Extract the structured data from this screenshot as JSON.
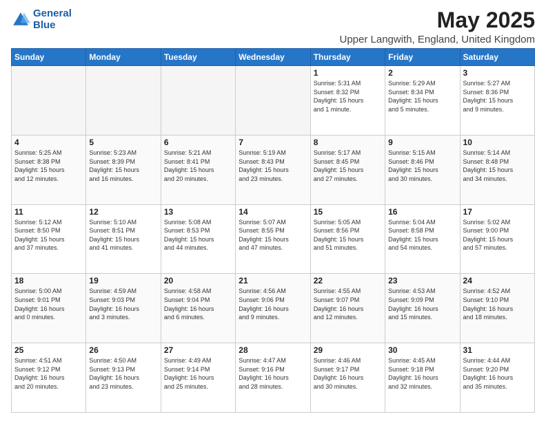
{
  "logo": {
    "line1": "General",
    "line2": "Blue"
  },
  "title": "May 2025",
  "location": "Upper Langwith, England, United Kingdom",
  "weekdays": [
    "Sunday",
    "Monday",
    "Tuesday",
    "Wednesday",
    "Thursday",
    "Friday",
    "Saturday"
  ],
  "weeks": [
    [
      {
        "day": "",
        "info": ""
      },
      {
        "day": "",
        "info": ""
      },
      {
        "day": "",
        "info": ""
      },
      {
        "day": "",
        "info": ""
      },
      {
        "day": "1",
        "info": "Sunrise: 5:31 AM\nSunset: 8:32 PM\nDaylight: 15 hours\nand 1 minute."
      },
      {
        "day": "2",
        "info": "Sunrise: 5:29 AM\nSunset: 8:34 PM\nDaylight: 15 hours\nand 5 minutes."
      },
      {
        "day": "3",
        "info": "Sunrise: 5:27 AM\nSunset: 8:36 PM\nDaylight: 15 hours\nand 9 minutes."
      }
    ],
    [
      {
        "day": "4",
        "info": "Sunrise: 5:25 AM\nSunset: 8:38 PM\nDaylight: 15 hours\nand 12 minutes."
      },
      {
        "day": "5",
        "info": "Sunrise: 5:23 AM\nSunset: 8:39 PM\nDaylight: 15 hours\nand 16 minutes."
      },
      {
        "day": "6",
        "info": "Sunrise: 5:21 AM\nSunset: 8:41 PM\nDaylight: 15 hours\nand 20 minutes."
      },
      {
        "day": "7",
        "info": "Sunrise: 5:19 AM\nSunset: 8:43 PM\nDaylight: 15 hours\nand 23 minutes."
      },
      {
        "day": "8",
        "info": "Sunrise: 5:17 AM\nSunset: 8:45 PM\nDaylight: 15 hours\nand 27 minutes."
      },
      {
        "day": "9",
        "info": "Sunrise: 5:15 AM\nSunset: 8:46 PM\nDaylight: 15 hours\nand 30 minutes."
      },
      {
        "day": "10",
        "info": "Sunrise: 5:14 AM\nSunset: 8:48 PM\nDaylight: 15 hours\nand 34 minutes."
      }
    ],
    [
      {
        "day": "11",
        "info": "Sunrise: 5:12 AM\nSunset: 8:50 PM\nDaylight: 15 hours\nand 37 minutes."
      },
      {
        "day": "12",
        "info": "Sunrise: 5:10 AM\nSunset: 8:51 PM\nDaylight: 15 hours\nand 41 minutes."
      },
      {
        "day": "13",
        "info": "Sunrise: 5:08 AM\nSunset: 8:53 PM\nDaylight: 15 hours\nand 44 minutes."
      },
      {
        "day": "14",
        "info": "Sunrise: 5:07 AM\nSunset: 8:55 PM\nDaylight: 15 hours\nand 47 minutes."
      },
      {
        "day": "15",
        "info": "Sunrise: 5:05 AM\nSunset: 8:56 PM\nDaylight: 15 hours\nand 51 minutes."
      },
      {
        "day": "16",
        "info": "Sunrise: 5:04 AM\nSunset: 8:58 PM\nDaylight: 15 hours\nand 54 minutes."
      },
      {
        "day": "17",
        "info": "Sunrise: 5:02 AM\nSunset: 9:00 PM\nDaylight: 15 hours\nand 57 minutes."
      }
    ],
    [
      {
        "day": "18",
        "info": "Sunrise: 5:00 AM\nSunset: 9:01 PM\nDaylight: 16 hours\nand 0 minutes."
      },
      {
        "day": "19",
        "info": "Sunrise: 4:59 AM\nSunset: 9:03 PM\nDaylight: 16 hours\nand 3 minutes."
      },
      {
        "day": "20",
        "info": "Sunrise: 4:58 AM\nSunset: 9:04 PM\nDaylight: 16 hours\nand 6 minutes."
      },
      {
        "day": "21",
        "info": "Sunrise: 4:56 AM\nSunset: 9:06 PM\nDaylight: 16 hours\nand 9 minutes."
      },
      {
        "day": "22",
        "info": "Sunrise: 4:55 AM\nSunset: 9:07 PM\nDaylight: 16 hours\nand 12 minutes."
      },
      {
        "day": "23",
        "info": "Sunrise: 4:53 AM\nSunset: 9:09 PM\nDaylight: 16 hours\nand 15 minutes."
      },
      {
        "day": "24",
        "info": "Sunrise: 4:52 AM\nSunset: 9:10 PM\nDaylight: 16 hours\nand 18 minutes."
      }
    ],
    [
      {
        "day": "25",
        "info": "Sunrise: 4:51 AM\nSunset: 9:12 PM\nDaylight: 16 hours\nand 20 minutes."
      },
      {
        "day": "26",
        "info": "Sunrise: 4:50 AM\nSunset: 9:13 PM\nDaylight: 16 hours\nand 23 minutes."
      },
      {
        "day": "27",
        "info": "Sunrise: 4:49 AM\nSunset: 9:14 PM\nDaylight: 16 hours\nand 25 minutes."
      },
      {
        "day": "28",
        "info": "Sunrise: 4:47 AM\nSunset: 9:16 PM\nDaylight: 16 hours\nand 28 minutes."
      },
      {
        "day": "29",
        "info": "Sunrise: 4:46 AM\nSunset: 9:17 PM\nDaylight: 16 hours\nand 30 minutes."
      },
      {
        "day": "30",
        "info": "Sunrise: 4:45 AM\nSunset: 9:18 PM\nDaylight: 16 hours\nand 32 minutes."
      },
      {
        "day": "31",
        "info": "Sunrise: 4:44 AM\nSunset: 9:20 PM\nDaylight: 16 hours\nand 35 minutes."
      }
    ]
  ]
}
